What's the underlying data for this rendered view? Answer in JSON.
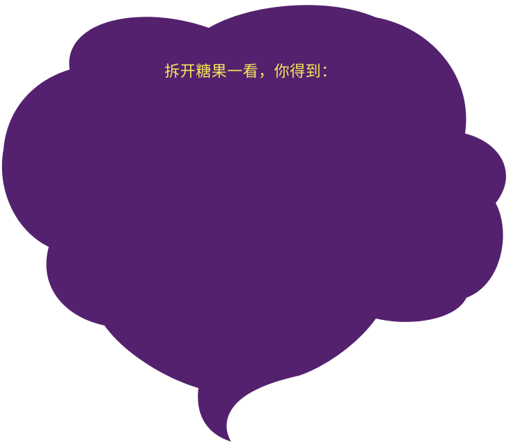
{
  "bubble": {
    "text": "拆开糖果一看，你得到：",
    "fill_color": "#54216e",
    "text_color": "#f4e45a",
    "icon": "thought-bubble-shape"
  }
}
